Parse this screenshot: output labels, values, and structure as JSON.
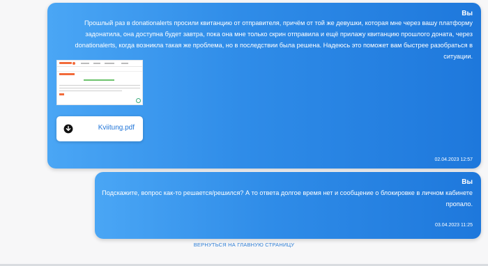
{
  "messages": [
    {
      "sender": "Вы",
      "text": "Прошлый раз в donationalerts просили квитанцию от отправителя, причём от той же девушки, которая мне через вашу платформу задонатила, она доступна будет завтра, пока она мне только скрин отправила и ещё прилажу квитанцию прошлого доната, через donationalerts, когда возникла такая же проблема, но в последствии была решена. Надеюсь это поможет вам быстрее разобраться в ситуации.",
      "attachment": {
        "file_name": "Kviitung.pdf",
        "icon": "download-icon"
      },
      "timestamp": "02.04.2023 12:57"
    },
    {
      "sender": "Вы",
      "text": "Подскажите, вопрос как-то решается/решился? А то ответа долгое время нет и сообщение о блокировке в личном кабинете пропало.",
      "timestamp": "03.04.2023 11:25"
    }
  ],
  "footer": {
    "back_link": "ВЕРНУТЬСЯ НА ГЛАВНУЮ СТРАНИЦУ"
  },
  "colors": {
    "bubble_gradient_start": "#4aa6f5",
    "bubble_gradient_end": "#1e78dc",
    "link": "#2f7fd6",
    "page_background": "#f7f7f8"
  }
}
